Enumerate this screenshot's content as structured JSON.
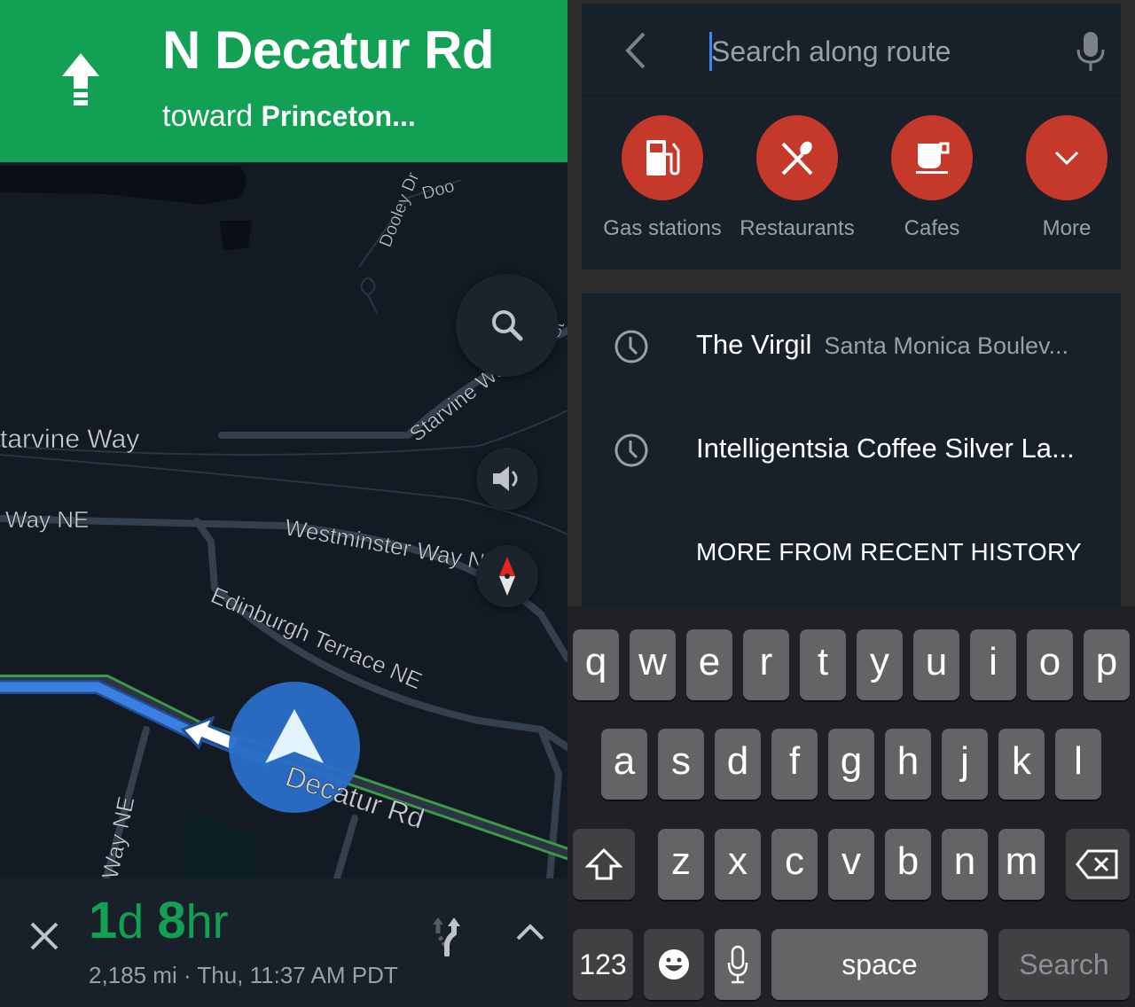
{
  "navigation": {
    "maneuver_icon": "straight-arrow-icon",
    "street": "N Decatur Rd",
    "toward_label": "toward",
    "toward_destination": "Princeton...",
    "map_labels": {
      "dooley_dr_1": "Dooley Dr",
      "dooley_dr_2": "Doo",
      "starvine_way_1": "tarvine Way",
      "starvine_way_2": "Starvine Way",
      "starvine_way_3": "St",
      "way_ne_1": "Way NE",
      "westminster": "Westminster Way NE",
      "edinburgh": "Edinburgh Terrace NE",
      "decatur": "Decatur Rd",
      "way_ne_2": "Way NE"
    },
    "eta": {
      "days": "1",
      "days_unit": "d",
      "hours": "8",
      "hours_unit": "hr"
    },
    "trip_info": "2,185 mi · Thu, 11:37 AM PDT",
    "colors": {
      "header": "#12a055",
      "route": "#3b7fe0",
      "eta": "#12a055"
    }
  },
  "search": {
    "placeholder": "Search along route",
    "categories": [
      {
        "label": "Gas stations",
        "icon": "gas-station-icon"
      },
      {
        "label": "Restaurants",
        "icon": "restaurant-icon"
      },
      {
        "label": "Cafes",
        "icon": "cafe-icon"
      },
      {
        "label": "More",
        "icon": "chevron-down-icon"
      }
    ],
    "history": [
      {
        "title": "The Virgil",
        "subtitle": "Santa Monica Boulev..."
      },
      {
        "title": "Intelligentsia Coffee Silver La...",
        "subtitle": ""
      }
    ],
    "more_history": "MORE FROM RECENT HISTORY",
    "accent": "#c5392a"
  },
  "keyboard": {
    "row1": [
      "q",
      "w",
      "e",
      "r",
      "t",
      "y",
      "u",
      "i",
      "o",
      "p"
    ],
    "row2": [
      "a",
      "s",
      "d",
      "f",
      "g",
      "h",
      "j",
      "k",
      "l"
    ],
    "row3": [
      "z",
      "x",
      "c",
      "v",
      "b",
      "n",
      "m"
    ],
    "numbers": "123",
    "space": "space",
    "action": "Search"
  }
}
